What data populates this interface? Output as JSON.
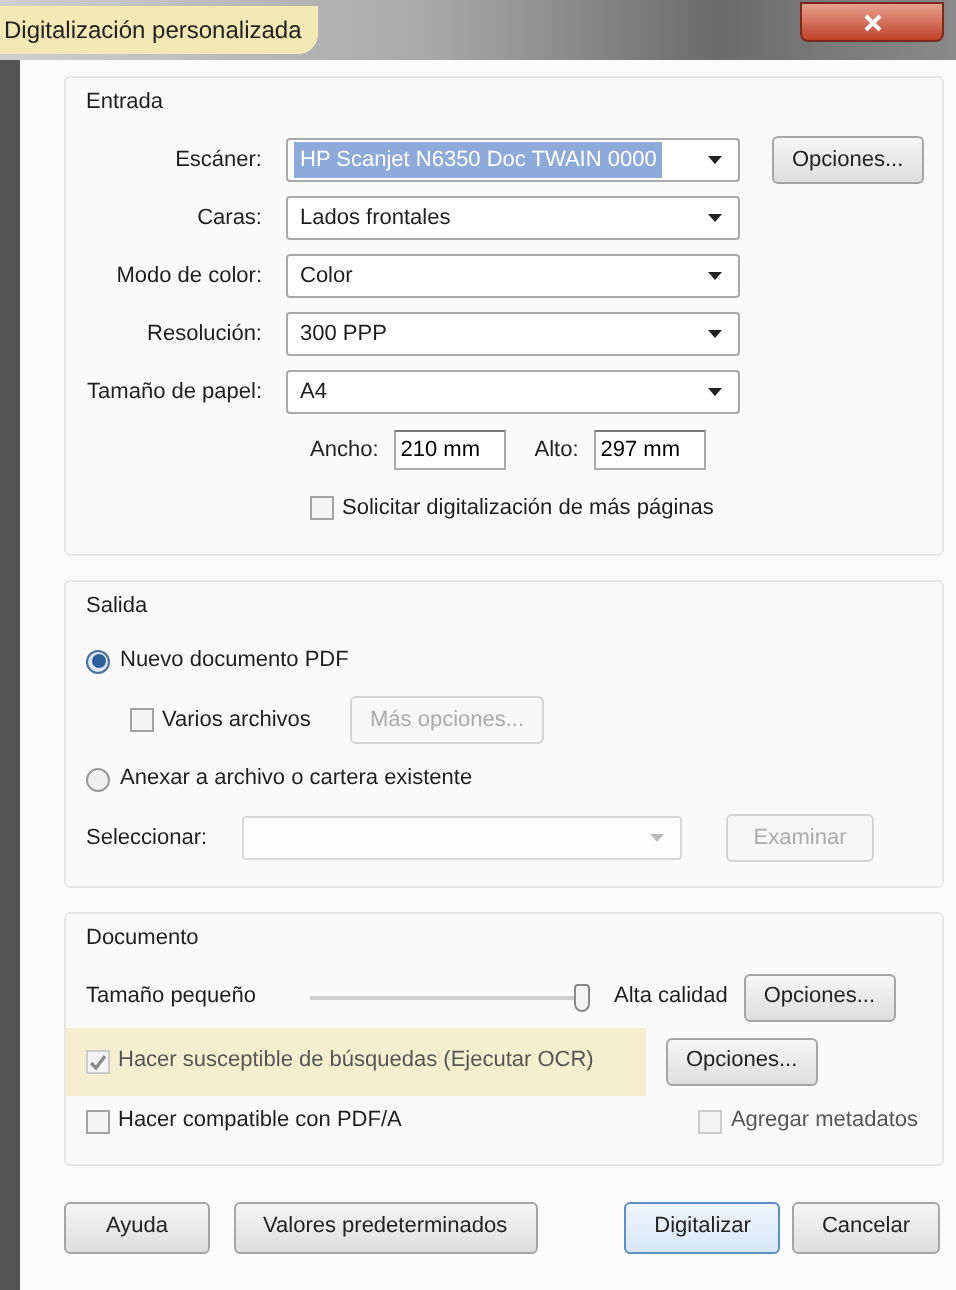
{
  "window": {
    "title": "Digitalización personalizada",
    "title_highlighted": true
  },
  "input": {
    "title": "Entrada",
    "fields": [
      {
        "label": "Escáner:",
        "value": "HP Scanjet N6350 Doc TWAIN 0000",
        "selected": true,
        "button": "Opciones..."
      },
      {
        "label": "Caras:",
        "value": "Lados frontales",
        "selected": false
      },
      {
        "label": "Modo de color:",
        "value": "Color",
        "selected": false
      },
      {
        "label": "Resolución:",
        "value": "300 PPP",
        "selected": false
      },
      {
        "label": "Tamaño de papel:",
        "value": "A4",
        "selected": false
      }
    ],
    "width_label": "Ancho:",
    "width_value": "210 mm",
    "height_label": "Alto:",
    "height_value": "297 mm",
    "more_pages": {
      "label": "Solicitar digitalización de más páginas",
      "checked": false
    }
  },
  "output": {
    "title": "Salida",
    "destinations": [
      {
        "label": "Nuevo documento PDF",
        "selected": true
      },
      {
        "label": "Anexar a archivo o cartera existente",
        "selected": false
      }
    ],
    "multiple_files": {
      "label": "Varios archivos",
      "checked": false
    },
    "more_options": {
      "label": "Más opciones...",
      "disabled": true
    },
    "select_label": "Seleccionar:",
    "select_disabled": true,
    "browse": {
      "label": "Examinar",
      "disabled": true
    }
  },
  "document": {
    "title": "Documento",
    "slider": {
      "min_label": "Tamaño pequeño",
      "max_label": "Alta calidad",
      "level": 1,
      "button": "Opciones..."
    },
    "ocr": {
      "label": "Hacer susceptible de búsquedas (Ejecutar OCR)",
      "checked": true,
      "disabled": true,
      "highlighted": true,
      "button": "Opciones..."
    },
    "pdfa": {
      "label": "Hacer compatible con PDF/A",
      "checked": false,
      "disabled": false
    },
    "metadata": {
      "label": "Agregar metadatos",
      "checked": false,
      "disabled": true
    }
  },
  "buttons_left": [
    {
      "label": "Ayuda",
      "default": false
    },
    {
      "label": "Valores predeterminados",
      "default": false
    }
  ],
  "buttons_right": [
    {
      "label": "Digitalizar",
      "default": true
    },
    {
      "label": "Cancelar",
      "default": false
    }
  ]
}
